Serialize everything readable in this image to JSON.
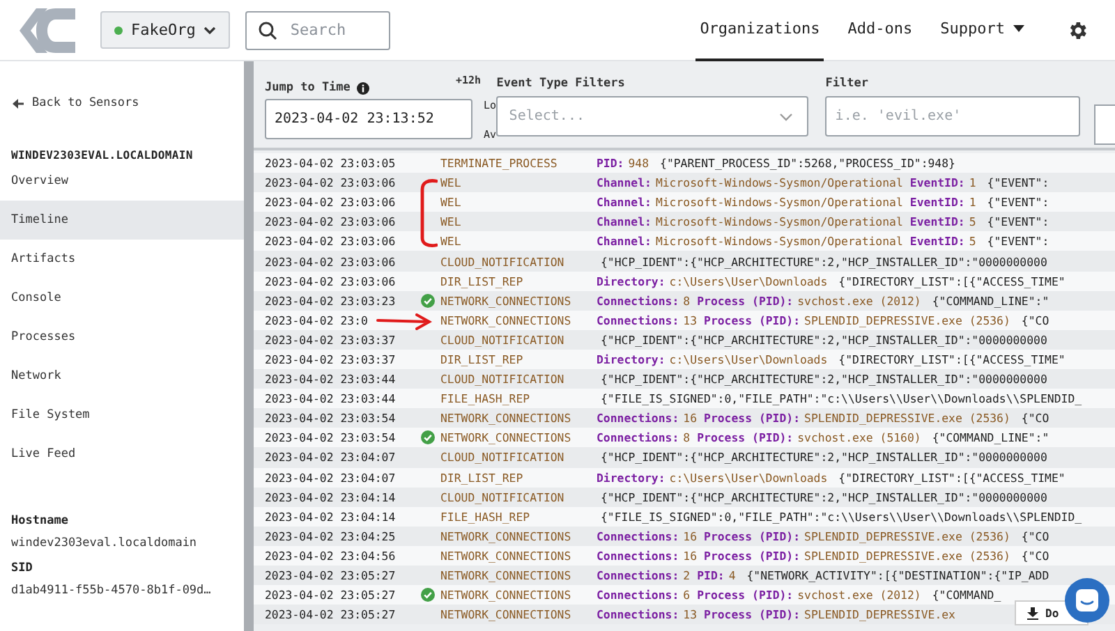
{
  "header": {
    "org": {
      "name": "FakeOrg"
    },
    "search": {
      "placeholder": "Search"
    },
    "nav": [
      {
        "label": "Organizations",
        "selected": true,
        "dropdown": false
      },
      {
        "label": "Add-ons",
        "selected": false,
        "dropdown": false
      },
      {
        "label": "Support",
        "selected": false,
        "dropdown": true
      }
    ]
  },
  "sidebar": {
    "back": "Back to Sensors",
    "host_title": "WINDEV2303EVAL.LOCALDOMAIN",
    "items": [
      {
        "label": "Overview",
        "selected": false
      },
      {
        "label": "Timeline",
        "selected": true
      },
      {
        "label": "Artifacts",
        "selected": false
      },
      {
        "label": "Console",
        "selected": false
      },
      {
        "label": "Processes",
        "selected": false
      },
      {
        "label": "Network",
        "selected": false
      },
      {
        "label": "File System",
        "selected": false
      },
      {
        "label": "Live Feed",
        "selected": false
      }
    ],
    "info": [
      {
        "label": "Hostname",
        "value": "windev2303eval.localdomain"
      },
      {
        "label": "SID",
        "value": "d1ab4911-f55b-4570-8b1f-09d…"
      }
    ]
  },
  "filters": {
    "jump_label": "Jump to Time",
    "jump_value": "2023-04-02 23:13:52",
    "offset": "+12h",
    "hidden_1": "Lo",
    "hidden_2": "Av",
    "event_label": "Event Type Filters",
    "event_placeholder": "Select...",
    "filter_label": "Filter",
    "filter_placeholder": "i.e. 'evil.exe'"
  },
  "rows": [
    {
      "time": "2023-04-02 23:03:05",
      "verified": false,
      "type": "TERMINATE_PROCESS",
      "parts": [
        {
          "kind": "label",
          "text": "PID:"
        },
        {
          "kind": "value",
          "text": "948"
        },
        {
          "kind": "json",
          "text": "{\"PARENT_PROCESS_ID\":5268,\"PROCESS_ID\":948}"
        }
      ]
    },
    {
      "time": "2023-04-02 23:03:06",
      "verified": false,
      "type": "WEL",
      "parts": [
        {
          "kind": "label",
          "text": "Channel:"
        },
        {
          "kind": "value",
          "text": "Microsoft-Windows-Sysmon/Operational"
        },
        {
          "kind": "label",
          "text": "EventID:"
        },
        {
          "kind": "value",
          "text": "1"
        },
        {
          "kind": "json",
          "text": "{\"EVENT\":"
        }
      ]
    },
    {
      "time": "2023-04-02 23:03:06",
      "verified": false,
      "type": "WEL",
      "parts": [
        {
          "kind": "label",
          "text": "Channel:"
        },
        {
          "kind": "value",
          "text": "Microsoft-Windows-Sysmon/Operational"
        },
        {
          "kind": "label",
          "text": "EventID:"
        },
        {
          "kind": "value",
          "text": "1"
        },
        {
          "kind": "json",
          "text": "{\"EVENT\":"
        }
      ]
    },
    {
      "time": "2023-04-02 23:03:06",
      "verified": false,
      "type": "WEL",
      "parts": [
        {
          "kind": "label",
          "text": "Channel:"
        },
        {
          "kind": "value",
          "text": "Microsoft-Windows-Sysmon/Operational"
        },
        {
          "kind": "label",
          "text": "EventID:"
        },
        {
          "kind": "value",
          "text": "5"
        },
        {
          "kind": "json",
          "text": "{\"EVENT\":"
        }
      ]
    },
    {
      "time": "2023-04-02 23:03:06",
      "verified": false,
      "type": "WEL",
      "parts": [
        {
          "kind": "label",
          "text": "Channel:"
        },
        {
          "kind": "value",
          "text": "Microsoft-Windows-Sysmon/Operational"
        },
        {
          "kind": "label",
          "text": "EventID:"
        },
        {
          "kind": "value",
          "text": "5"
        },
        {
          "kind": "json",
          "text": "{\"EVENT\":"
        }
      ]
    },
    {
      "time": "2023-04-02 23:03:06",
      "verified": false,
      "type": "CLOUD_NOTIFICATION",
      "parts": [
        {
          "kind": "json",
          "text": "{\"HCP_IDENT\":{\"HCP_ARCHITECTURE\":2,\"HCP_INSTALLER_ID\":\"0000000000"
        }
      ]
    },
    {
      "time": "2023-04-02 23:03:06",
      "verified": false,
      "type": "DIR_LIST_REP",
      "parts": [
        {
          "kind": "label",
          "text": "Directory:"
        },
        {
          "kind": "value",
          "text": "c:\\Users\\User\\Downloads"
        },
        {
          "kind": "json",
          "text": "{\"DIRECTORY_LIST\":[{\"ACCESS_TIME\""
        }
      ]
    },
    {
      "time": "2023-04-02 23:03:23",
      "verified": true,
      "type": "NETWORK_CONNECTIONS",
      "parts": [
        {
          "kind": "label",
          "text": "Connections:"
        },
        {
          "kind": "value",
          "text": "8"
        },
        {
          "kind": "label",
          "text": "Process (PID):"
        },
        {
          "kind": "value",
          "text": "svchost.exe (2012)"
        },
        {
          "kind": "json",
          "text": "{\"COMMAND_LINE\":\""
        }
      ]
    },
    {
      "time": "2023-04-02 23:0",
      "verified": false,
      "type": "NETWORK_CONNECTIONS",
      "parts": [
        {
          "kind": "label",
          "text": "Connections:"
        },
        {
          "kind": "value",
          "text": "13"
        },
        {
          "kind": "label",
          "text": "Process (PID):"
        },
        {
          "kind": "value",
          "text": "SPLENDID_DEPRESSIVE.exe (2536)"
        },
        {
          "kind": "json",
          "text": "{\"CO"
        }
      ]
    },
    {
      "time": "2023-04-02 23:03:37",
      "verified": false,
      "type": "CLOUD_NOTIFICATION",
      "parts": [
        {
          "kind": "json",
          "text": "{\"HCP_IDENT\":{\"HCP_ARCHITECTURE\":2,\"HCP_INSTALLER_ID\":\"0000000000"
        }
      ]
    },
    {
      "time": "2023-04-02 23:03:37",
      "verified": false,
      "type": "DIR_LIST_REP",
      "parts": [
        {
          "kind": "label",
          "text": "Directory:"
        },
        {
          "kind": "value",
          "text": "c:\\Users\\User\\Downloads"
        },
        {
          "kind": "json",
          "text": "{\"DIRECTORY_LIST\":[{\"ACCESS_TIME\""
        }
      ]
    },
    {
      "time": "2023-04-02 23:03:44",
      "verified": false,
      "type": "CLOUD_NOTIFICATION",
      "parts": [
        {
          "kind": "json",
          "text": "{\"HCP_IDENT\":{\"HCP_ARCHITECTURE\":2,\"HCP_INSTALLER_ID\":\"0000000000"
        }
      ]
    },
    {
      "time": "2023-04-02 23:03:44",
      "verified": false,
      "type": "FILE_HASH_REP",
      "parts": [
        {
          "kind": "json",
          "text": "{\"FILE_IS_SIGNED\":0,\"FILE_PATH\":\"c:\\\\Users\\\\User\\\\Downloads\\\\SPLENDID_"
        }
      ]
    },
    {
      "time": "2023-04-02 23:03:54",
      "verified": false,
      "type": "NETWORK_CONNECTIONS",
      "parts": [
        {
          "kind": "label",
          "text": "Connections:"
        },
        {
          "kind": "value",
          "text": "16"
        },
        {
          "kind": "label",
          "text": "Process (PID):"
        },
        {
          "kind": "value",
          "text": "SPLENDID_DEPRESSIVE.exe (2536)"
        },
        {
          "kind": "json",
          "text": "{\"CO"
        }
      ]
    },
    {
      "time": "2023-04-02 23:03:54",
      "verified": true,
      "type": "NETWORK_CONNECTIONS",
      "parts": [
        {
          "kind": "label",
          "text": "Connections:"
        },
        {
          "kind": "value",
          "text": "8"
        },
        {
          "kind": "label",
          "text": "Process (PID):"
        },
        {
          "kind": "value",
          "text": "svchost.exe (5160)"
        },
        {
          "kind": "json",
          "text": "{\"COMMAND_LINE\":\""
        }
      ]
    },
    {
      "time": "2023-04-02 23:04:07",
      "verified": false,
      "type": "CLOUD_NOTIFICATION",
      "parts": [
        {
          "kind": "json",
          "text": "{\"HCP_IDENT\":{\"HCP_ARCHITECTURE\":2,\"HCP_INSTALLER_ID\":\"0000000000"
        }
      ]
    },
    {
      "time": "2023-04-02 23:04:07",
      "verified": false,
      "type": "DIR_LIST_REP",
      "parts": [
        {
          "kind": "label",
          "text": "Directory:"
        },
        {
          "kind": "value",
          "text": "c:\\Users\\User\\Downloads"
        },
        {
          "kind": "json",
          "text": "{\"DIRECTORY_LIST\":[{\"ACCESS_TIME\""
        }
      ]
    },
    {
      "time": "2023-04-02 23:04:14",
      "verified": false,
      "type": "CLOUD_NOTIFICATION",
      "parts": [
        {
          "kind": "json",
          "text": "{\"HCP_IDENT\":{\"HCP_ARCHITECTURE\":2,\"HCP_INSTALLER_ID\":\"0000000000"
        }
      ]
    },
    {
      "time": "2023-04-02 23:04:14",
      "verified": false,
      "type": "FILE_HASH_REP",
      "parts": [
        {
          "kind": "json",
          "text": "{\"FILE_IS_SIGNED\":0,\"FILE_PATH\":\"c:\\\\Users\\\\User\\\\Downloads\\\\SPLENDID_"
        }
      ]
    },
    {
      "time": "2023-04-02 23:04:25",
      "verified": false,
      "type": "NETWORK_CONNECTIONS",
      "parts": [
        {
          "kind": "label",
          "text": "Connections:"
        },
        {
          "kind": "value",
          "text": "16"
        },
        {
          "kind": "label",
          "text": "Process (PID):"
        },
        {
          "kind": "value",
          "text": "SPLENDID_DEPRESSIVE.exe (2536)"
        },
        {
          "kind": "json",
          "text": "{\"CO"
        }
      ]
    },
    {
      "time": "2023-04-02 23:04:56",
      "verified": false,
      "type": "NETWORK_CONNECTIONS",
      "parts": [
        {
          "kind": "label",
          "text": "Connections:"
        },
        {
          "kind": "value",
          "text": "16"
        },
        {
          "kind": "label",
          "text": "Process (PID):"
        },
        {
          "kind": "value",
          "text": "SPLENDID_DEPRESSIVE.exe (2536)"
        },
        {
          "kind": "json",
          "text": "{\"CO"
        }
      ]
    },
    {
      "time": "2023-04-02 23:05:27",
      "verified": false,
      "type": "NETWORK_CONNECTIONS",
      "parts": [
        {
          "kind": "label",
          "text": "Connections:"
        },
        {
          "kind": "value",
          "text": "2"
        },
        {
          "kind": "label",
          "text": "PID:"
        },
        {
          "kind": "value",
          "text": "4"
        },
        {
          "kind": "json",
          "text": "{\"NETWORK_ACTIVITY\":[{\"DESTINATION\":{\"IP_ADD"
        }
      ]
    },
    {
      "time": "2023-04-02 23:05:27",
      "verified": true,
      "type": "NETWORK_CONNECTIONS",
      "parts": [
        {
          "kind": "label",
          "text": "Connections:"
        },
        {
          "kind": "value",
          "text": "6"
        },
        {
          "kind": "label",
          "text": "Process (PID):"
        },
        {
          "kind": "value",
          "text": "svchost.exe (2012)"
        },
        {
          "kind": "json",
          "text": "{\"COMMAND_"
        }
      ]
    },
    {
      "time": "2023-04-02 23:05:27",
      "verified": false,
      "type": "NETWORK_CONNECTIONS",
      "parts": [
        {
          "kind": "label",
          "text": "Connections:"
        },
        {
          "kind": "value",
          "text": "13"
        },
        {
          "kind": "label",
          "text": "Process (PID):"
        },
        {
          "kind": "value",
          "text": "SPLENDID_DEPRESSIVE.ex"
        }
      ]
    }
  ],
  "download": {
    "label": "Do"
  }
}
